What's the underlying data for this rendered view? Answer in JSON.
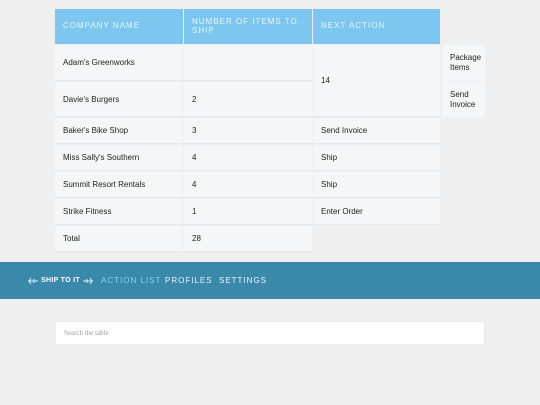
{
  "table": {
    "headers": [
      "Company Name",
      "Number of Items to Ship",
      "Next Action"
    ],
    "rows": [
      {
        "company": "Adam's Greenworks",
        "items": "",
        "action": ""
      },
      {
        "company": "Davie's Burgers",
        "items": "2",
        "action": ""
      },
      {
        "company": "Baker's Bike Shop",
        "items": "3",
        "action": "Send Invoice"
      },
      {
        "company": "Miss Sally's Southern",
        "items": "4",
        "action": "Ship"
      },
      {
        "company": "Summit Resort Rentals",
        "items": "4",
        "action": "Ship"
      },
      {
        "company": "Strike Fitness",
        "items": "1",
        "action": "Enter Order"
      }
    ],
    "merged_items_value": "14",
    "total": {
      "label": "Total",
      "value": "28"
    },
    "side_cells": [
      "Package Items",
      "Send Invoice"
    ]
  },
  "nav": {
    "logo_text": "SHIP TO IT",
    "links": [
      {
        "label": "Action List",
        "active": true
      },
      {
        "label": "Profiles",
        "active": false
      },
      {
        "label": "Settings",
        "active": false
      }
    ]
  },
  "search": {
    "placeholder": "Search the table",
    "value": ""
  },
  "colors": {
    "header": "#7cc6ef",
    "navbar": "#3a89ab",
    "cell": "#f5f6f7",
    "background": "#efefef"
  }
}
